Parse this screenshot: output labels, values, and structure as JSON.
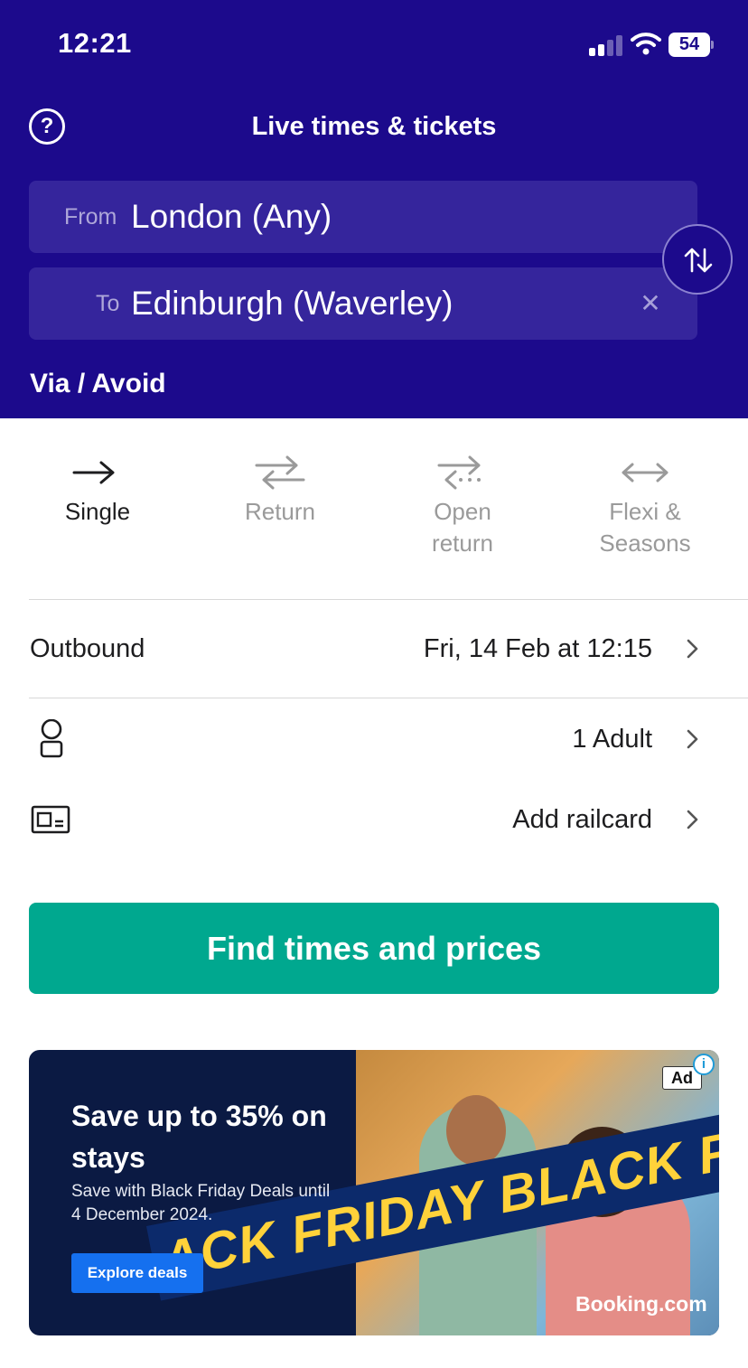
{
  "status_bar": {
    "time": "12:21",
    "battery": "54"
  },
  "header": {
    "title": "Live times & tickets",
    "help_symbol": "?",
    "from_label": "From",
    "from_value": "London (Any)",
    "to_label": "To",
    "to_value": "Edinburgh (Waverley)",
    "clear_symbol": "✕",
    "via_label": "Via / Avoid"
  },
  "ticket_types": [
    {
      "label": "Single",
      "icon": "arrow-right-icon",
      "active": true
    },
    {
      "label": "Return",
      "icon": "arrows-swap-icon",
      "active": false
    },
    {
      "label": "Open return",
      "icon": "arrows-open-return-icon",
      "active": false
    },
    {
      "label": "Flexi & Seasons",
      "icon": "arrow-both-icon",
      "active": false
    }
  ],
  "journey": {
    "outbound_label": "Outbound",
    "outbound_value": "Fri, 14 Feb at 12:15",
    "passengers_value": "1 Adult",
    "railcard_value": "Add railcard"
  },
  "cta_label": "Find times and prices",
  "ad": {
    "headline": "Save up to 35% on stays",
    "subtext": "Save with Black Friday Deals until 4 December 2024.",
    "button_label": "Explore deals",
    "badge": "Ad",
    "info_symbol": "i",
    "brand": "Booking.com",
    "banner_text": "ACK FRIDAY BLACK FRIDAY BLAC"
  },
  "colors": {
    "header_bg": "#1c0a8c",
    "field_bg": "#35259c",
    "cta_bg": "#00a88f",
    "ad_bg": "#0b1a43"
  }
}
